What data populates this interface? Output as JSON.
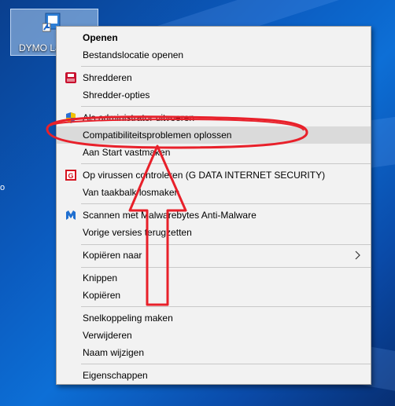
{
  "desktop": {
    "icon_label": "DYMO La",
    "edge_text": "o"
  },
  "menu": {
    "items": [
      {
        "label": "Openen"
      },
      {
        "label": "Bestandslocatie openen"
      },
      {
        "label": "Shredderen"
      },
      {
        "label": "Shredder-opties"
      },
      {
        "label": "Als administrator uitvoeren"
      },
      {
        "label": "Compatibiliteitsproblemen oplossen"
      },
      {
        "label": "Aan Start vastmaken"
      },
      {
        "label": "Op virussen controleren (G DATA INTERNET SECURITY)"
      },
      {
        "label": "Van taakbalk losmaken"
      },
      {
        "label": "Scannen met Malwarebytes Anti-Malware"
      },
      {
        "label": "Vorige versies terugzetten"
      },
      {
        "label": "Kopiëren naar"
      },
      {
        "label": "Knippen"
      },
      {
        "label": "Kopiëren"
      },
      {
        "label": "Snelkoppeling maken"
      },
      {
        "label": "Verwijderen"
      },
      {
        "label": "Naam wijzigen"
      },
      {
        "label": "Eigenschappen"
      }
    ]
  },
  "colors": {
    "highlight": "#dadada",
    "annotation": "#e8202a",
    "menu_bg": "#f2f2f2"
  }
}
